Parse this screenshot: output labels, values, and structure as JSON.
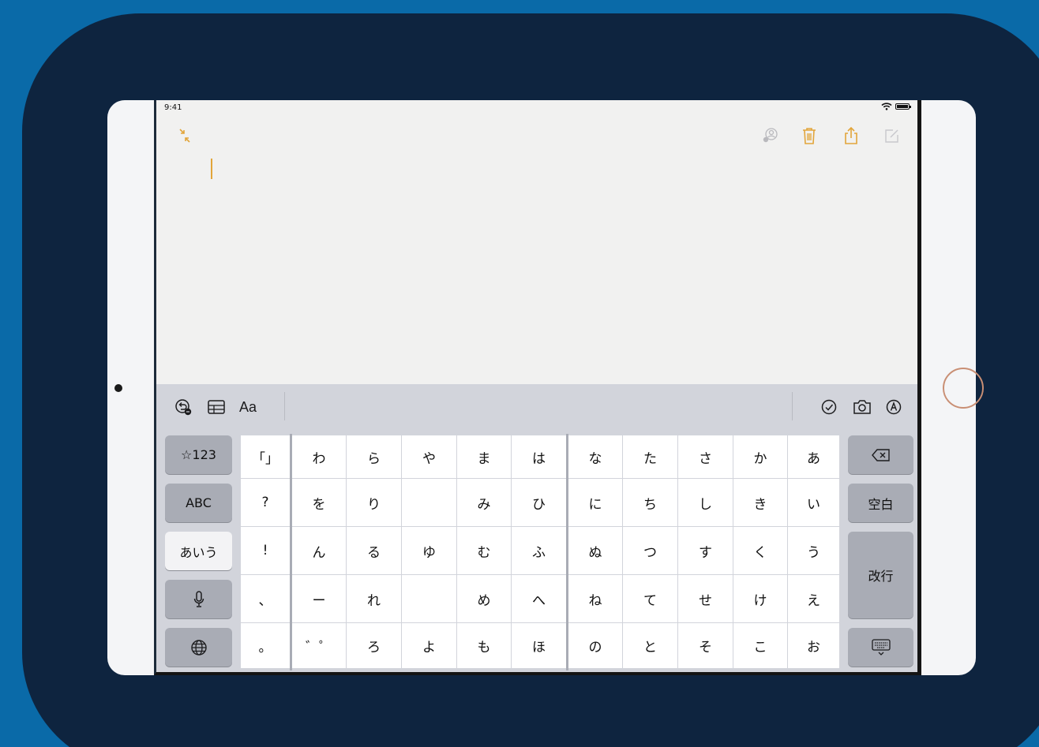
{
  "status_bar": {
    "time": "9:41"
  },
  "accent_color": "#e2a53a",
  "note_toolbar": {
    "icons": [
      "collapse-icon",
      "collaborate-icon",
      "trash-icon",
      "share-icon",
      "compose-icon"
    ]
  },
  "accessory_bar": {
    "format_label": "Aa",
    "icons": [
      "undo-icon",
      "table-icon",
      "checklist-icon",
      "camera-icon",
      "markup-icon"
    ]
  },
  "keyboard": {
    "left_keys": [
      "☆123",
      "ABC",
      "あいう",
      "mic",
      "globe"
    ],
    "right_keys": [
      "delete",
      "空白",
      "改行",
      "hide-keyboard"
    ],
    "grid": [
      [
        "「」",
        "わ",
        "ら",
        "や",
        "ま",
        "は",
        "な",
        "た",
        "さ",
        "か",
        "あ"
      ],
      [
        "?",
        "を",
        "り",
        "",
        "み",
        "ひ",
        "に",
        "ち",
        "し",
        "き",
        "い"
      ],
      [
        "!",
        "ん",
        "る",
        "ゆ",
        "む",
        "ふ",
        "ぬ",
        "つ",
        "す",
        "く",
        "う"
      ],
      [
        "、",
        "ー",
        "れ",
        "",
        "め",
        "へ",
        "ね",
        "て",
        "せ",
        "け",
        "え"
      ],
      [
        "。",
        "゛゜",
        "ろ",
        "よ",
        "も",
        "ほ",
        "の",
        "と",
        "そ",
        "こ",
        "お"
      ]
    ]
  }
}
